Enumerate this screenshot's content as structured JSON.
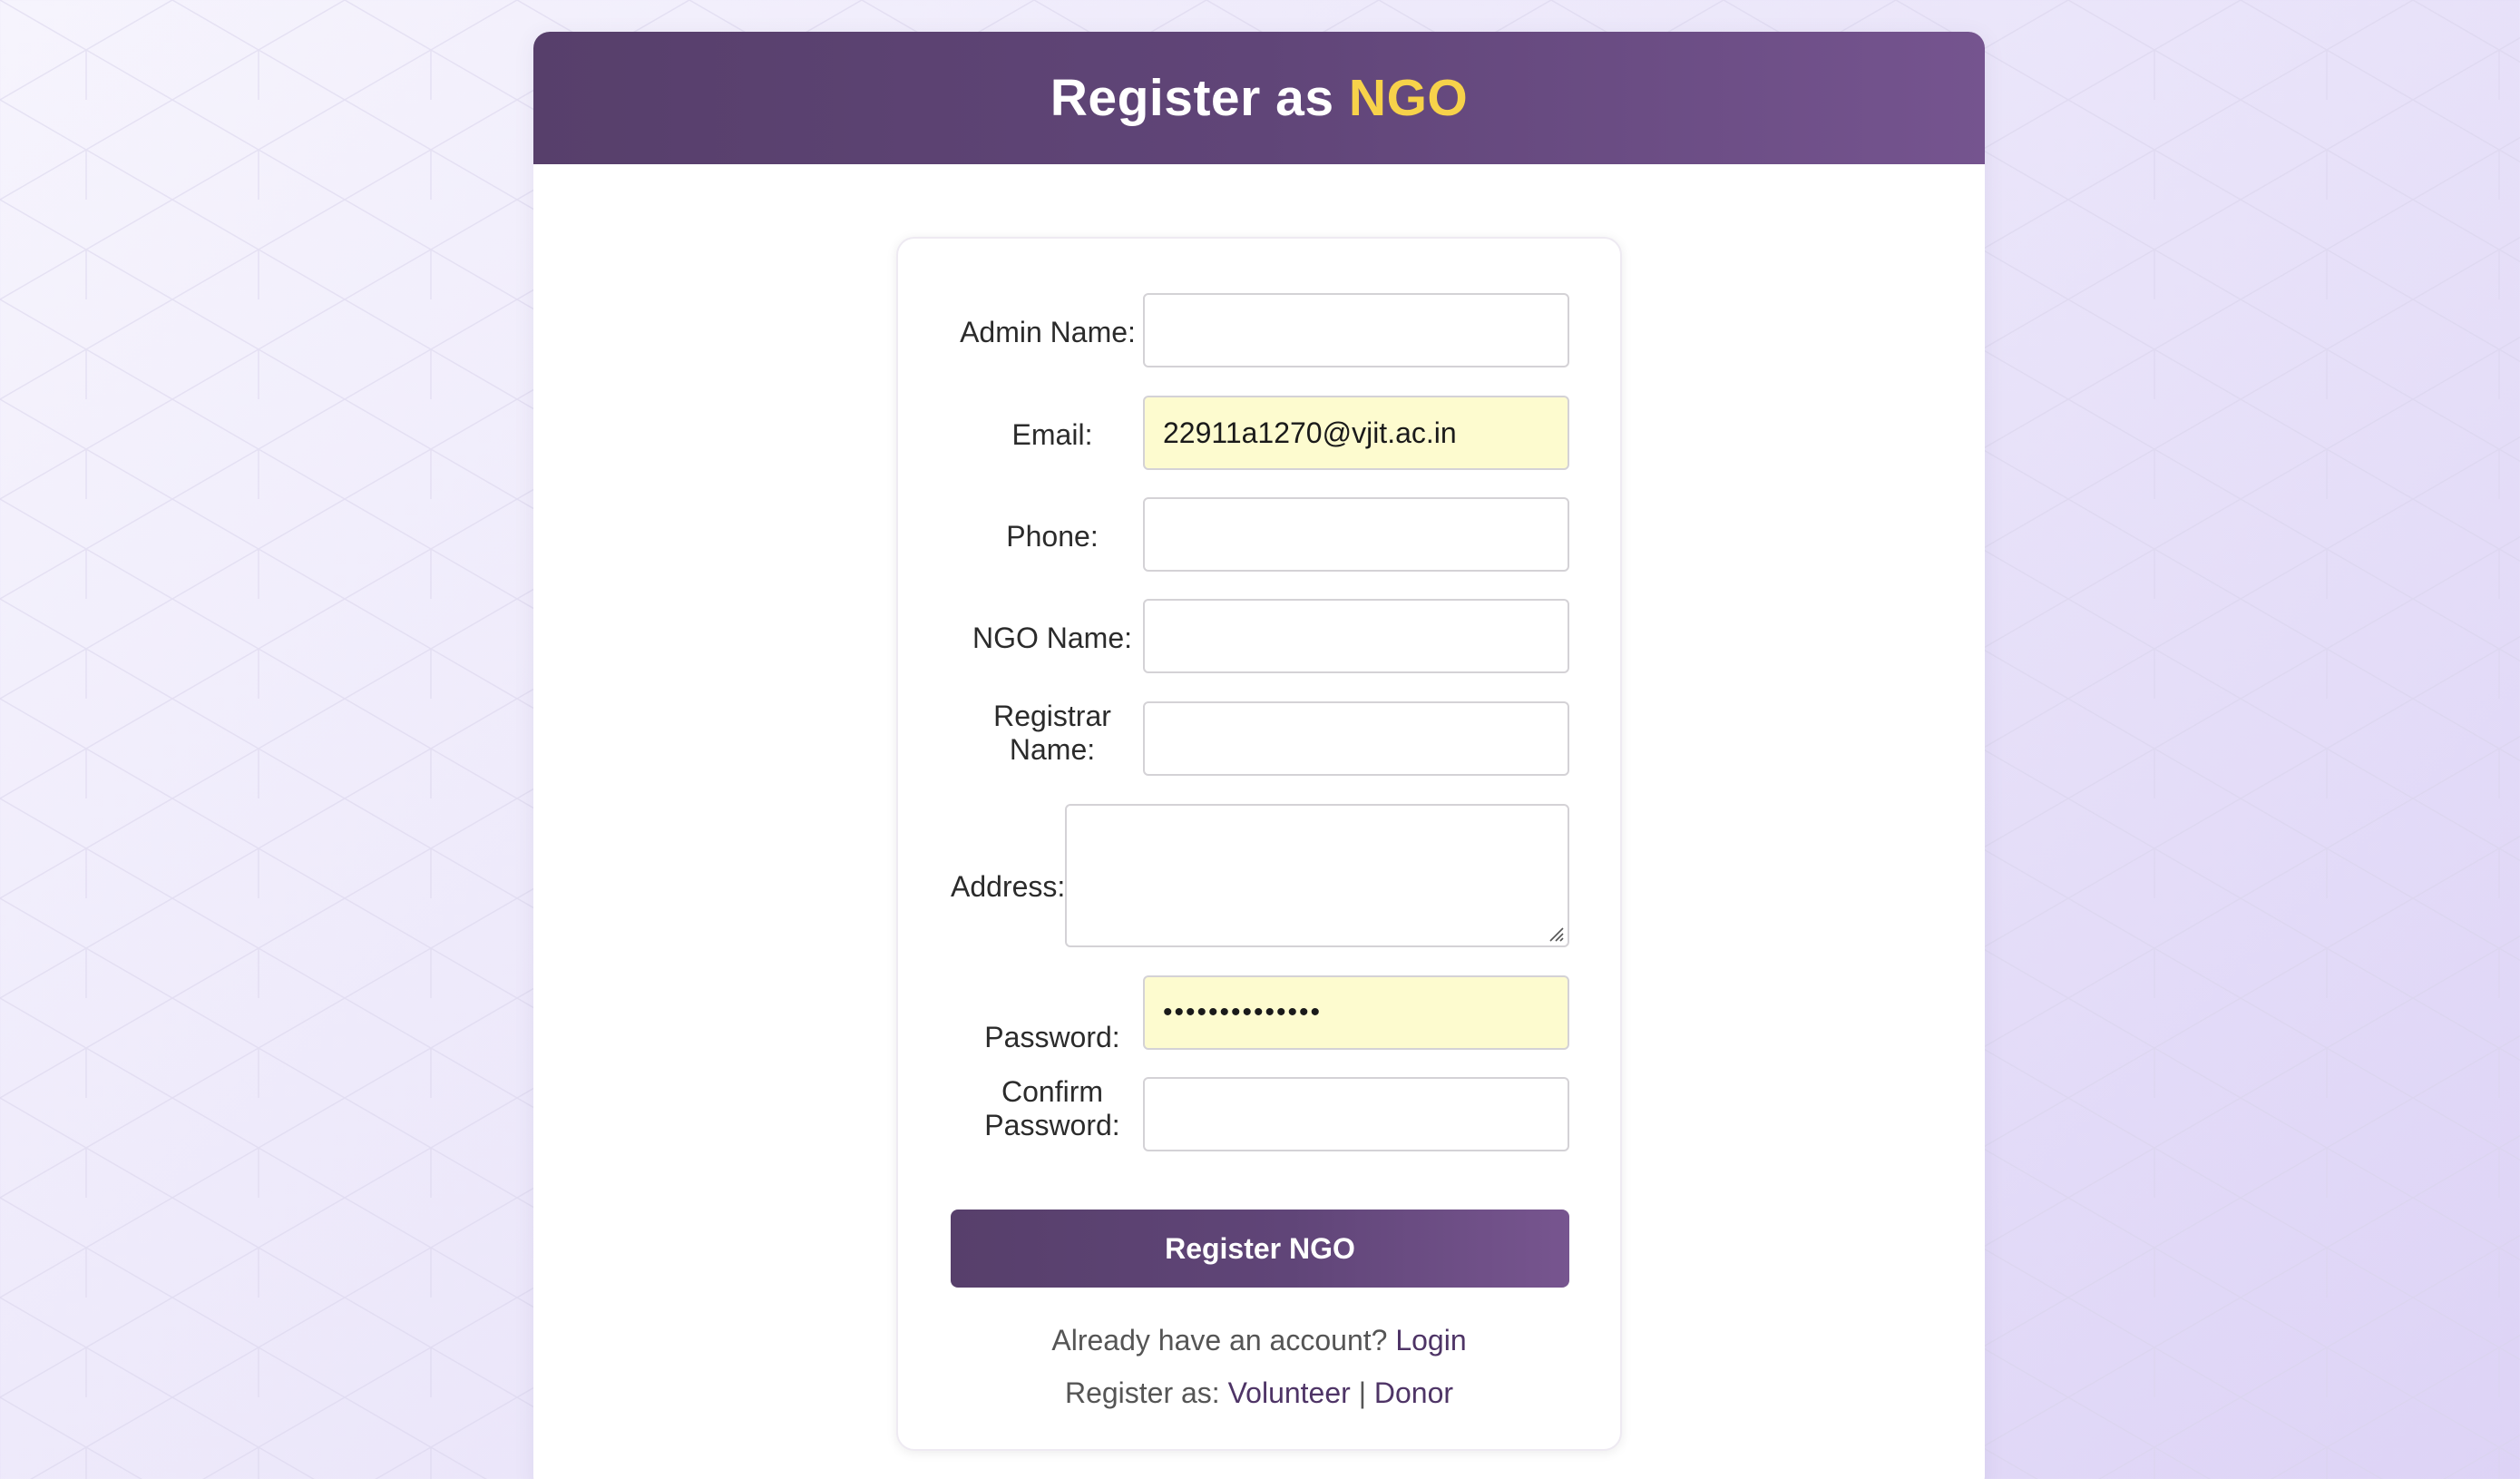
{
  "header": {
    "title_prefix": "Register as",
    "title_highlight": "NGO"
  },
  "form": {
    "admin_name": {
      "label": "Admin Name:",
      "value": ""
    },
    "email": {
      "label": "Email:",
      "value": "22911a1270@vjit.ac.in"
    },
    "phone": {
      "label": "Phone:",
      "value": ""
    },
    "ngo_name": {
      "label": "NGO Name:",
      "value": ""
    },
    "registrar_name": {
      "label_line1": "Registrar",
      "label_line2": "Name:",
      "value": ""
    },
    "address": {
      "label": "Address:",
      "value": ""
    },
    "password": {
      "label": "Password:",
      "value": "••••••••••••••"
    },
    "confirm_password": {
      "label_line1": "Confirm",
      "label_line2": "Password:",
      "value": ""
    },
    "submit_label": "Register NGO"
  },
  "footer": {
    "account_prompt": "Already have an account?",
    "login_link": "Login",
    "register_as_prompt": "Register as:",
    "volunteer_link": "Volunteer",
    "separator": "|",
    "donor_link": "Donor"
  },
  "colors": {
    "accent": "#5d4374",
    "highlight": "#f7d24a",
    "autofill": "#fdfbcf"
  }
}
